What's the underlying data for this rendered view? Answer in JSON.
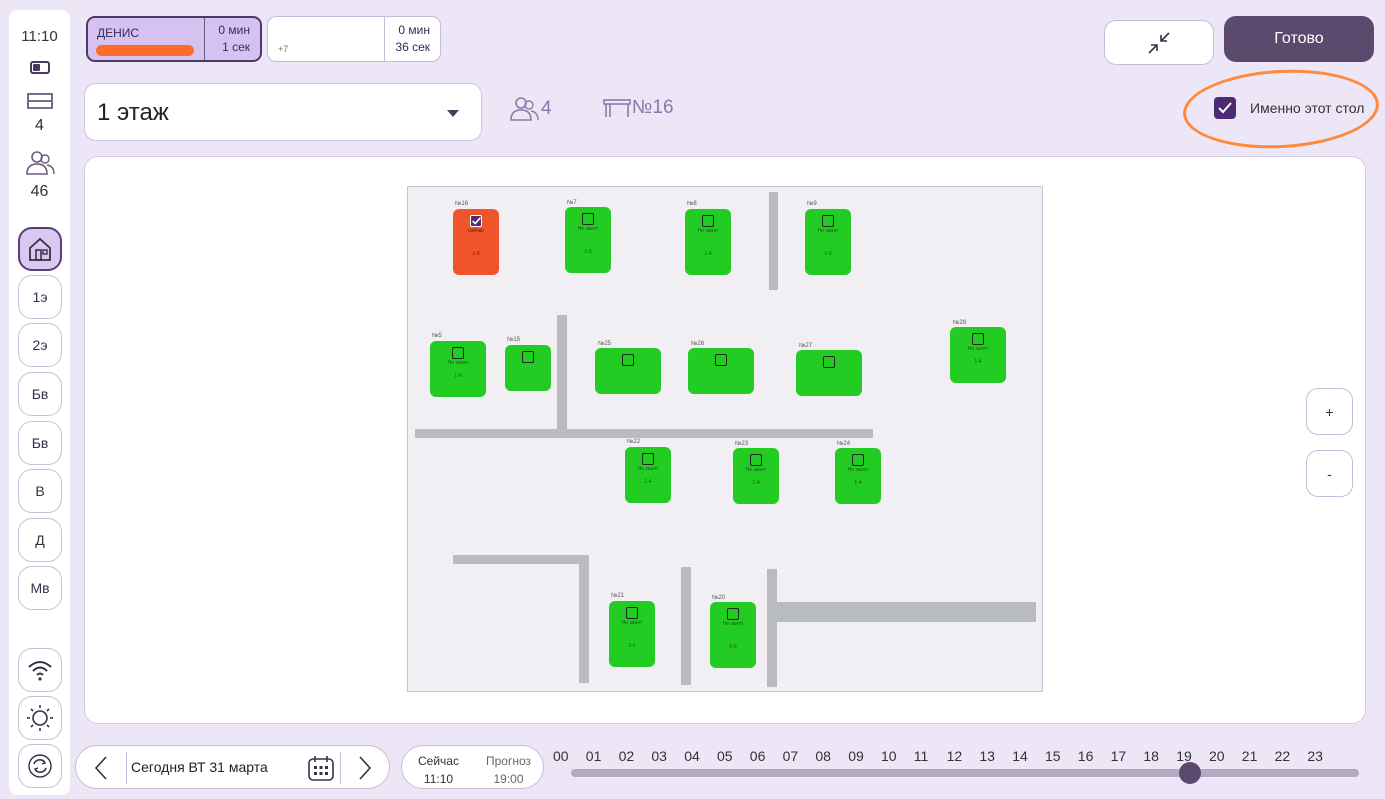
{
  "status": {
    "time": "11:10"
  },
  "rail": {
    "tables_count": "4",
    "people_count": "46",
    "floors": [
      "1э",
      "2э",
      "Бв",
      "Бв",
      "В",
      "Д",
      "Мв"
    ]
  },
  "timers": {
    "user": {
      "name": "ДЕНИС",
      "min": "0 мин",
      "sec": "1 сек"
    },
    "other": {
      "extra": "+7",
      "min": "0 мин",
      "sec": "36 сек"
    }
  },
  "toolbar": {
    "done_label": "Готово"
  },
  "floor_select": {
    "value": "1 этаж"
  },
  "info": {
    "people": "4",
    "table": "№16"
  },
  "exact_table": {
    "label": "Именно этот стол",
    "checked": true
  },
  "desks": [
    {
      "num": "№16",
      "status": "сейчас",
      "cap": "1-6",
      "busy": true
    },
    {
      "num": "№7",
      "status": "Не занят",
      "cap": "1-6"
    },
    {
      "num": "№8",
      "status": "Не занят",
      "cap": "1-4"
    },
    {
      "num": "№9",
      "status": "Не занят",
      "cap": "1-6"
    },
    {
      "num": "№5",
      "status": "Не занят",
      "cap": "1-6"
    },
    {
      "num": "№15",
      "status": "",
      "cap": ""
    },
    {
      "num": "№25",
      "status": "",
      "cap": ""
    },
    {
      "num": "№26",
      "status": "",
      "cap": ""
    },
    {
      "num": "№27",
      "status": "",
      "cap": ""
    },
    {
      "num": "№28",
      "status": "Не занят",
      "cap": "1-4"
    },
    {
      "num": "№22",
      "status": "Не занят",
      "cap": "1-4"
    },
    {
      "num": "№23",
      "status": "Не занят",
      "cap": "1-4"
    },
    {
      "num": "№24",
      "status": "Не занят",
      "cap": "1-4"
    },
    {
      "num": "№21",
      "status": "Не занят",
      "cap": "1-6"
    },
    {
      "num": "№20",
      "status": "Не занят",
      "cap": "1-6"
    }
  ],
  "zoom": {
    "in": "+",
    "out": "-"
  },
  "date_nav": {
    "label": "Сегодня ВТ 31 марта"
  },
  "now_box": {
    "now_label": "Сейчас",
    "now_time": "11:10",
    "forecast_label": "Прогноз",
    "forecast_time": "19:00"
  },
  "timeline": {
    "hours": [
      "00",
      "01",
      "02",
      "03",
      "04",
      "05",
      "06",
      "07",
      "08",
      "09",
      "10",
      "11",
      "12",
      "13",
      "14",
      "15",
      "16",
      "17",
      "18",
      "19",
      "20",
      "21",
      "22",
      "23"
    ],
    "selected_hour": 19
  },
  "colors": {
    "accent": "#5b4a6e",
    "free": "#22cc22",
    "busy": "#f0542a",
    "highlight": "#ff8a3a"
  }
}
